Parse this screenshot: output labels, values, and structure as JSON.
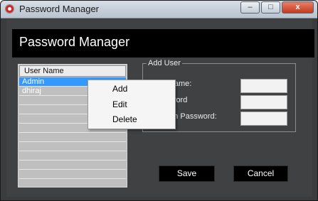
{
  "window": {
    "title": "Password Manager",
    "minimize_glyph": "–",
    "maximize_glyph": "□",
    "close_glyph": "x"
  },
  "header": {
    "title": "Password Manager"
  },
  "user_list": {
    "column_header": "User Name",
    "rows": [
      "Admin",
      "dhiraj"
    ],
    "selected": "Admin"
  },
  "add_user": {
    "legend": "Add User",
    "user_name_label": "r name:",
    "password_label": "sword",
    "confirm_label": "firm Password:"
  },
  "buttons": {
    "save": "Save",
    "cancel": "Cancel"
  },
  "context_menu": {
    "add": "Add",
    "edit": "Edit",
    "delete": "Delete"
  },
  "colors": {
    "window_bg": "#3f4143",
    "header_bg": "#000000",
    "selection": "#3399ff"
  },
  "icons": {
    "app": "record-icon"
  }
}
